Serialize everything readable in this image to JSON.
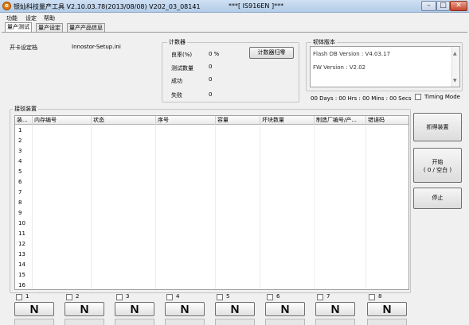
{
  "window": {
    "title": "银灿科技量产工具 V2.10.03.78(2013/08/08)   V202_03_08141",
    "title_center": "***[ IS916EN ]***",
    "app_icon_glyph": "e",
    "minimize": "–",
    "maximize": "□",
    "close": "✕"
  },
  "menu": [
    "功能",
    "设定",
    "帮助"
  ],
  "tabs": [
    "量产测试",
    "量产设定",
    "量产产品信息"
  ],
  "config": {
    "label": "开卡设定档",
    "file": "Innostor-Setup.ini"
  },
  "counter": {
    "title": "计数器",
    "rows": [
      {
        "label": "良率(%)",
        "value": "0 %"
      },
      {
        "label": "测试数量",
        "value": "0"
      },
      {
        "label": "成功",
        "value": "0"
      },
      {
        "label": "失败",
        "value": "0"
      }
    ],
    "reset_button": "计数器归零"
  },
  "firmware": {
    "title": "韧体版本",
    "flash_db": "Flash DB Version :  V4.03.17",
    "fw": "FW Version :   V2.02"
  },
  "timer": "00 Days : 00 Hrs : 00 Mins : 00 Secs",
  "timing_mode": "Timing Mode",
  "device_group": {
    "title": "接驳装置",
    "columns": [
      "装...",
      "内存编号",
      "状态",
      "序号",
      "容量",
      "坏块数量",
      "制造厂编号/产...",
      "错误码"
    ],
    "rows": [
      "1",
      "2",
      "3",
      "4",
      "5",
      "6",
      "7",
      "8",
      "9",
      "10",
      "11",
      "12",
      "13",
      "14",
      "15",
      "16"
    ]
  },
  "side_buttons": {
    "get_devices": "抓得装置",
    "start_line1": "开始",
    "start_line2": "( 0 / 空白 )",
    "stop": "停止"
  },
  "ports": [
    {
      "num": "1",
      "status": "N"
    },
    {
      "num": "2",
      "status": "N"
    },
    {
      "num": "3",
      "status": "N"
    },
    {
      "num": "4",
      "status": "N"
    },
    {
      "num": "5",
      "status": "N"
    },
    {
      "num": "6",
      "status": "N"
    },
    {
      "num": "7",
      "status": "N"
    },
    {
      "num": "8",
      "status": "N"
    }
  ],
  "scroll_icons": {
    "up": "▲",
    "down": "▼"
  }
}
